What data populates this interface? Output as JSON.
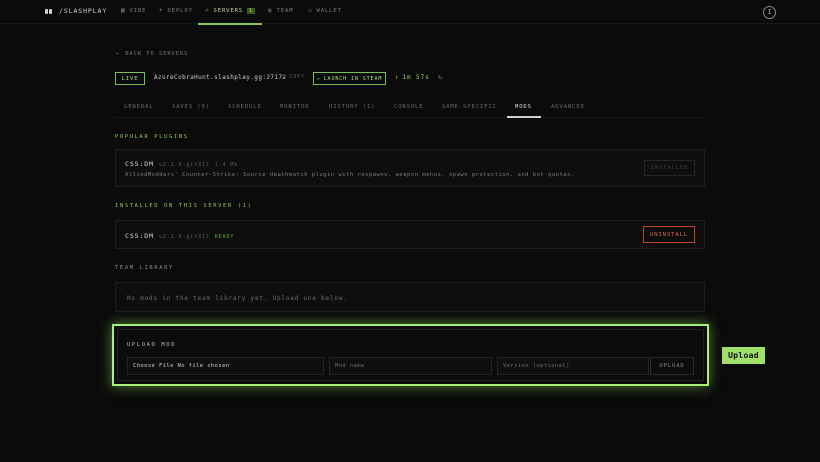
{
  "nav": {
    "brand": "/SLASHPLAY",
    "items": [
      {
        "label": "VIBE",
        "icon": "grid-icon"
      },
      {
        "label": "DEPLOY",
        "icon": "plus-icon"
      },
      {
        "label": "SERVERS",
        "icon": "rocket-icon",
        "badge": "1"
      },
      {
        "label": "TEAM",
        "icon": "user-icon"
      },
      {
        "label": "WALLET",
        "icon": "wallet-icon"
      }
    ],
    "avatar_initial": "I"
  },
  "back_link": "BACK TO SERVERS",
  "server": {
    "status": "LIVE",
    "address": "AzureCobraHunt.slashplay.gg:27172",
    "copy_label": "COPY",
    "launch_label": "LAUNCH IN STEAM",
    "uptime": "1m 57s"
  },
  "tabs": [
    "GENERAL",
    "SAVES (0)",
    "SCHEDULE",
    "MONITOR",
    "HISTORY (1)",
    "CONSOLE",
    "GAME-SPECIFIC",
    "MODS",
    "ADVANCED"
  ],
  "popular": {
    "title": "POPULAR PLUGINS",
    "plugin": {
      "name": "CSS:DM",
      "version": "v2.1.6-git317",
      "size": "1.4 Mb",
      "description": "AlliedModders' Counter-Strike: Source deathmatch plugin with respawns, weapon menus, spawn protection, and bot quotas.",
      "button": "INSTALLED"
    }
  },
  "installed": {
    "title": "INSTALLED ON THIS SERVER (1)",
    "plugin": {
      "name": "CSS:DM",
      "version": "v2.1.6-git317",
      "status": "READY",
      "button": "UNINSTALL"
    }
  },
  "library": {
    "title": "TEAM LIBRARY",
    "empty": "No mods in the team library yet. Upload one below."
  },
  "upload": {
    "title": "UPLOAD MOD",
    "file_label": "Choose File No file chosen",
    "name_placeholder": "Mod name",
    "version_placeholder": "Version (optional)",
    "button": "UPLOAD"
  },
  "tooltip": "Upload",
  "colors": {
    "accent": "#8ec460",
    "danger": "#b9422f",
    "background": "#0b0b0b"
  }
}
